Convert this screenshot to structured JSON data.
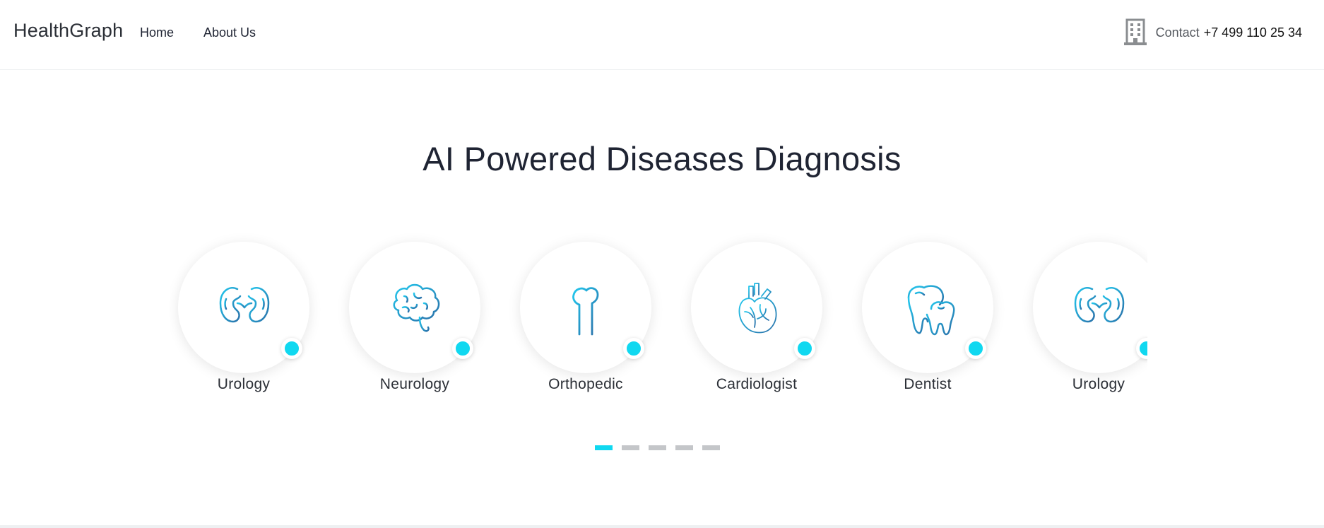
{
  "header": {
    "brand": "HealthGraph",
    "nav": [
      {
        "label": "Home"
      },
      {
        "label": "About Us"
      }
    ],
    "contact_label": "Contact",
    "contact_phone": "+7 499 110 25 34",
    "contact_icon": "building-icon"
  },
  "hero": {
    "title": "AI Powered Diseases Diagnosis"
  },
  "specialties": [
    {
      "label": "Urology",
      "icon": "kidneys-icon"
    },
    {
      "label": "Neurology",
      "icon": "brain-icon"
    },
    {
      "label": "Orthopedic",
      "icon": "bone-icon"
    },
    {
      "label": "Cardiologist",
      "icon": "heart-icon"
    },
    {
      "label": "Dentist",
      "icon": "tooth-icon"
    },
    {
      "label": "Urology",
      "icon": "kidneys-icon"
    }
  ],
  "pager": {
    "count": 5,
    "active": 0
  },
  "colors": {
    "accent": "#10d8f0",
    "text_dark": "#1f2433",
    "icon_gradient_start": "#22c8ee",
    "icon_gradient_end": "#2a6fa8",
    "pager_inactive": "#c4c6c9"
  }
}
